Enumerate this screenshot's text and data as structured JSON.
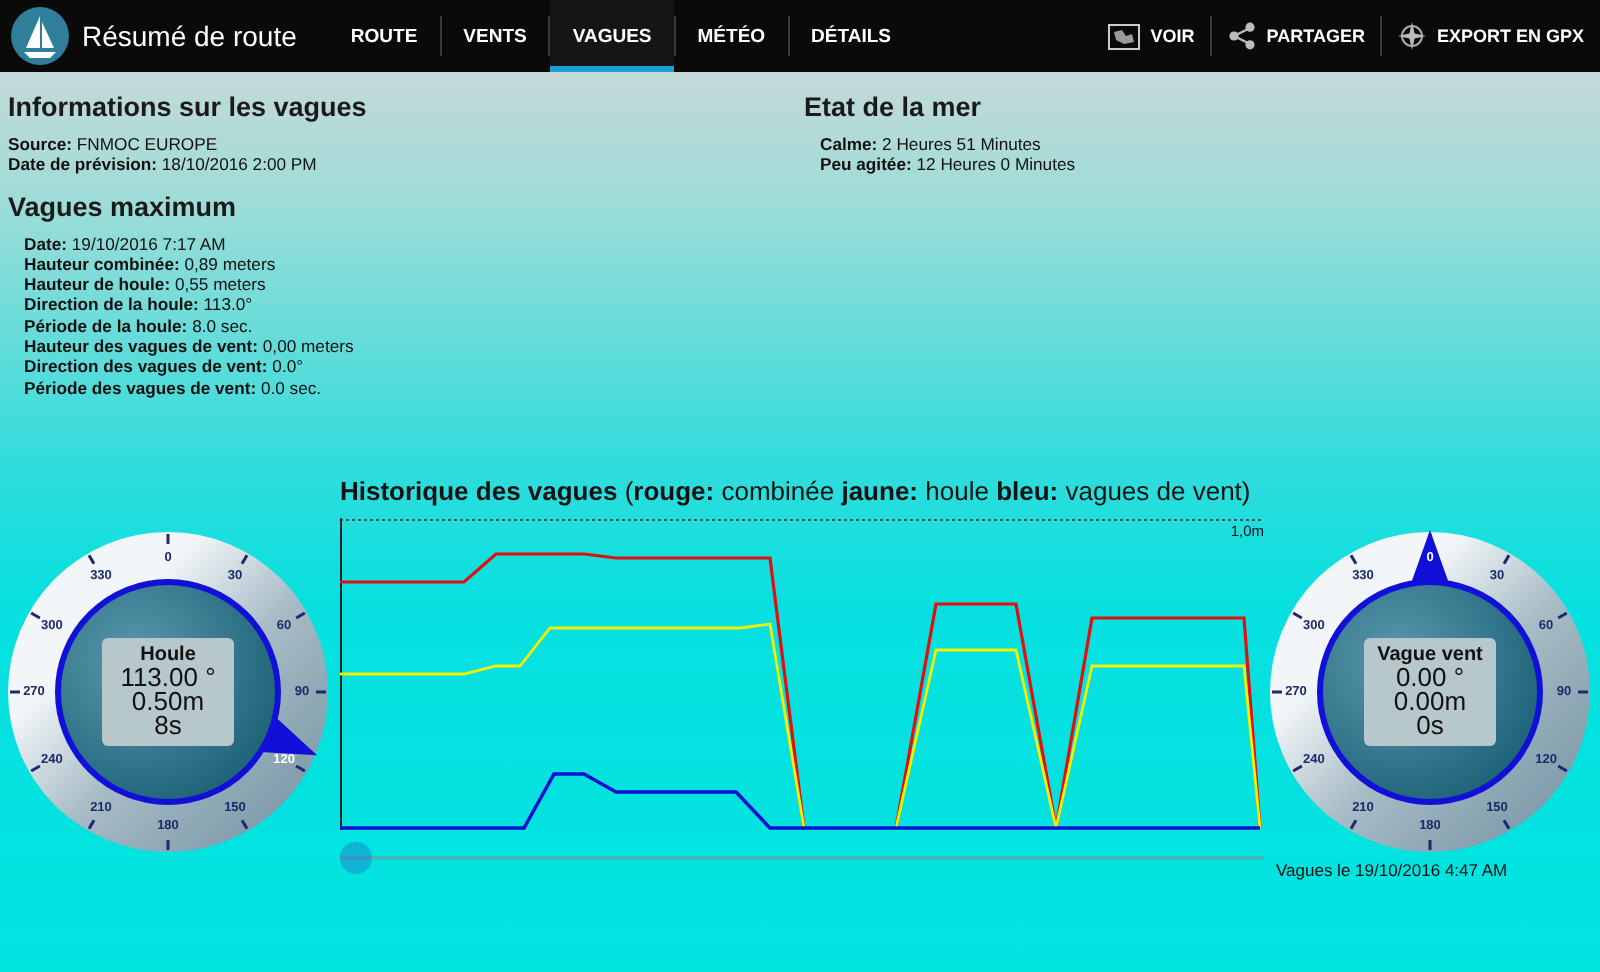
{
  "app": {
    "title": "Résumé de route"
  },
  "tabs": [
    {
      "label": "ROUTE",
      "selected": false
    },
    {
      "label": "VENTS",
      "selected": false
    },
    {
      "label": "VAGUES",
      "selected": true
    },
    {
      "label": "MÉTÉO",
      "selected": false
    },
    {
      "label": "DÉTAILS",
      "selected": false
    }
  ],
  "actions": [
    {
      "kind": "map",
      "label": "VOIR"
    },
    {
      "kind": "share",
      "label": "PARTAGER"
    },
    {
      "kind": "export",
      "label": "EXPORT EN GPX"
    }
  ],
  "wave_info": {
    "title": "Informations sur les vagues",
    "lines": [
      {
        "label": "Source:",
        "value": "FNMOC EUROPE"
      },
      {
        "label": "Date de prévision:",
        "value": "18/10/2016 2:00 PM"
      }
    ]
  },
  "sea_state": {
    "title": "Etat de la mer",
    "lines": [
      {
        "label": "Calme:",
        "value": "2 Heures 51 Minutes"
      },
      {
        "label": "Peu agitée:",
        "value": "12 Heures 0 Minutes"
      }
    ]
  },
  "max_waves": {
    "title": "Vagues maximum",
    "lines": [
      {
        "label": "Date:",
        "value": "19/10/2016 7:17 AM"
      },
      {
        "label": "Hauteur combinée:",
        "value": "0,89 meters"
      },
      {
        "label": "Hauteur de houle:",
        "value": "0,55 meters"
      },
      {
        "label": "Direction de la houle:",
        "value": "113.0°"
      },
      {
        "label": "Période de la houle:",
        "value": "8.0 sec."
      },
      {
        "label": "Hauteur des vagues de vent:",
        "value": "0,00 meters"
      },
      {
        "label": "Direction des vagues de vent:",
        "value": "0.0°"
      },
      {
        "label": "Période des vagues de vent:",
        "value": "0.0 sec."
      }
    ]
  },
  "dials": [
    {
      "title": "Houle",
      "direction": "113.00 °",
      "height": "0.50m",
      "period": "8s",
      "ticks": [
        "0",
        "30",
        "60",
        "90",
        "120",
        "150",
        "180",
        "210",
        "240",
        "270",
        "300",
        "330"
      ]
    },
    {
      "title": "Vague vent",
      "direction": "0.00 °",
      "height": "0.00m",
      "period": "0s",
      "ticks": [
        "0",
        "30",
        "60",
        "90",
        "120",
        "150",
        "180",
        "210",
        "240",
        "270",
        "300",
        "330"
      ]
    }
  ],
  "history": {
    "title": "**Historique des vagues** (**rouge:** combinée **jaune:** houle **bleu:** vagues de vent)",
    "max_label": "1,0m"
  },
  "slider": {
    "level": 0
  },
  "timestamp": "Vagues le 19/10/2016 4:47 AM"
}
